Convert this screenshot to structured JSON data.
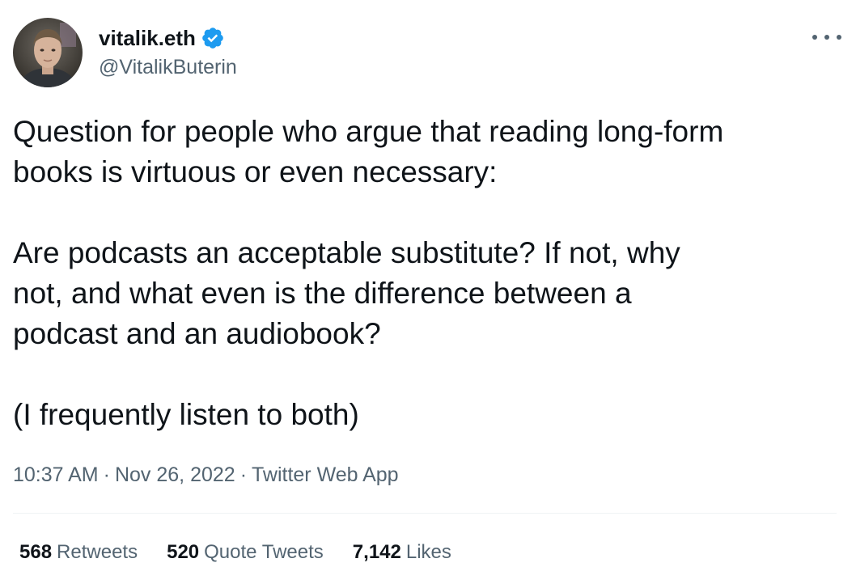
{
  "author": {
    "display_name": "vitalik.eth",
    "handle": "@VitalikButerin",
    "verified_icon": "verified-badge-icon",
    "avatar_icon": "profile-photo"
  },
  "more_icon": "more-dots-icon",
  "tweet": {
    "paragraphs": [
      "Question for people who argue that reading long-form\nbooks is virtuous or even necessary:",
      "Are podcasts an acceptable substitute? If not, why\nnot, and what even is the difference between a\npodcast and an audiobook?",
      "(I frequently listen to both)"
    ]
  },
  "meta": {
    "time": "10:37 AM",
    "separator": "·",
    "date": "Nov 26, 2022",
    "source": "Twitter Web App"
  },
  "stats": {
    "retweets": {
      "count": "568",
      "label": "Retweets"
    },
    "quotes": {
      "count": "520",
      "label": "Quote Tweets"
    },
    "likes": {
      "count": "7,142",
      "label": "Likes"
    }
  },
  "colors": {
    "text_primary": "#0f1419",
    "text_secondary": "#536471",
    "verified_blue": "#1d9bf0",
    "divider": "#eff3f4"
  }
}
